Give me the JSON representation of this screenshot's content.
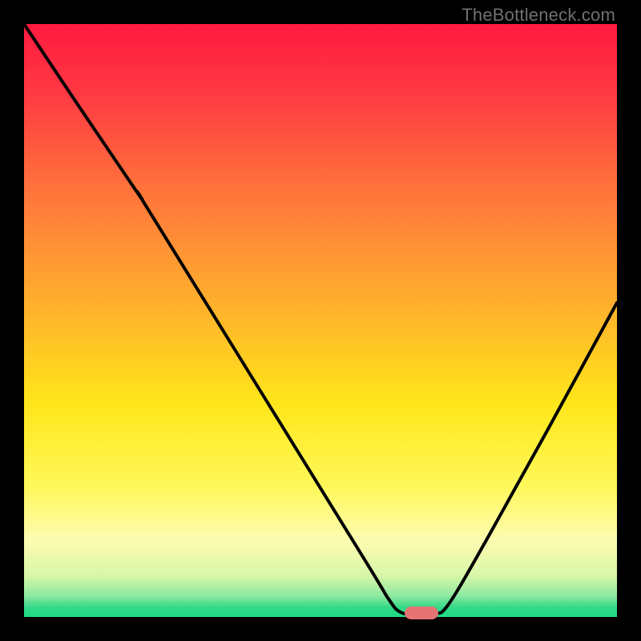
{
  "watermark": "TheBottleneck.com",
  "chart_data": {
    "type": "line",
    "title": "",
    "xlabel": "",
    "ylabel": "",
    "xlim": [
      0,
      100
    ],
    "ylim": [
      0,
      100
    ],
    "grid": false,
    "legend": false,
    "gradient_stops": [
      {
        "pos": 0.0,
        "color": "#ff1a3f"
      },
      {
        "pos": 0.12,
        "color": "#ff3a43"
      },
      {
        "pos": 0.3,
        "color": "#ff7a3a"
      },
      {
        "pos": 0.48,
        "color": "#ffb22b"
      },
      {
        "pos": 0.64,
        "color": "#ffe61a"
      },
      {
        "pos": 0.78,
        "color": "#fff85a"
      },
      {
        "pos": 0.87,
        "color": "#fdfcb0"
      },
      {
        "pos": 0.93,
        "color": "#d8f7a8"
      },
      {
        "pos": 0.965,
        "color": "#8be8a0"
      },
      {
        "pos": 0.985,
        "color": "#2fd987"
      },
      {
        "pos": 1.0,
        "color": "#1fdc88"
      }
    ],
    "series": [
      {
        "name": "bottleneck-curve",
        "points": [
          {
            "x": 0.0,
            "y": 100.0
          },
          {
            "x": 9.0,
            "y": 86.5
          },
          {
            "x": 19.5,
            "y": 71.0
          },
          {
            "x": 22.0,
            "y": 67.0
          },
          {
            "x": 56.0,
            "y": 12.0
          },
          {
            "x": 61.5,
            "y": 3.0
          },
          {
            "x": 63.5,
            "y": 0.8
          },
          {
            "x": 66.0,
            "y": 0.4
          },
          {
            "x": 69.0,
            "y": 0.6
          },
          {
            "x": 71.5,
            "y": 2.0
          },
          {
            "x": 78.0,
            "y": 13.0
          },
          {
            "x": 88.0,
            "y": 31.0
          },
          {
            "x": 100.0,
            "y": 53.0
          }
        ]
      }
    ],
    "marker": {
      "x": 67.0,
      "y": 0.7
    }
  }
}
